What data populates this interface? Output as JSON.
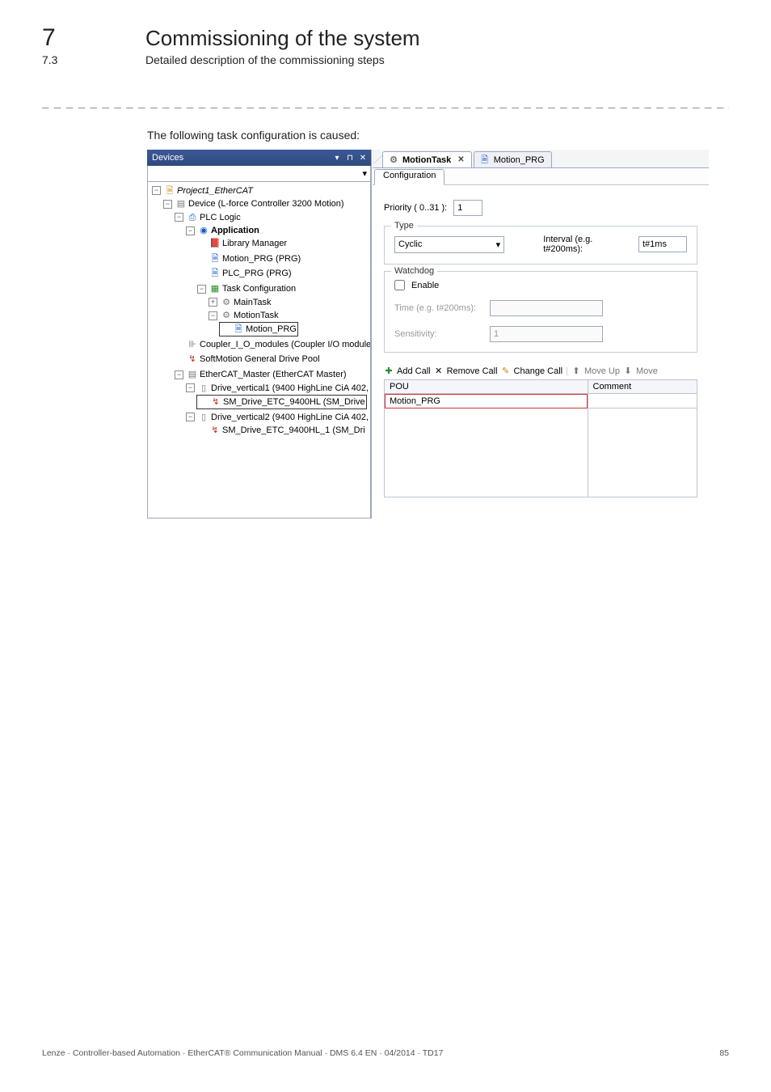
{
  "page": {
    "chapter_num": "7",
    "chapter_title": "Commissioning of the system",
    "section_num": "7.3",
    "section_title": "Detailed description of the commissioning steps",
    "intro": "The following task configuration is caused:",
    "footer_left": "Lenze · Controller-based Automation · EtherCAT® Communication Manual · DMS 6.4 EN · 04/2014 · TD17",
    "footer_right": "85"
  },
  "devices": {
    "title": "Devices",
    "combo_value": "Project1_EtherCAT",
    "tree": {
      "root_label": "Project1_EtherCAT",
      "device_label": "Device (L-force Controller 3200 Motion)",
      "plc_logic": "PLC Logic",
      "application": "Application",
      "library_manager": "Library Manager",
      "motion_prg": "Motion_PRG (PRG)",
      "plc_prg": "PLC_PRG (PRG)",
      "task_config": "Task Configuration",
      "main_task": "MainTask",
      "motion_task": "MotionTask",
      "motion_task_child": "Motion_PRG",
      "coupler": "Coupler_I_O_modules (Coupler I/O modules)",
      "softmotion": "SoftMotion General Drive Pool",
      "ecat_master": "EtherCAT_Master (EtherCAT Master)",
      "drive1": "Drive_vertical1 (9400 HighLine CiA 402,",
      "drive1_child": "SM_Drive_ETC_9400HL (SM_Drive",
      "drive2": "Drive_vertical2 (9400 HighLine CiA 402,",
      "drive2_child": "SM_Drive_ETC_9400HL_1 (SM_Dri"
    }
  },
  "editor": {
    "file_tabs": [
      {
        "label": "MotionTask",
        "active": true
      },
      {
        "label": "Motion_PRG",
        "active": false
      }
    ],
    "config_tab": "Configuration",
    "priority_label": "Priority ( 0..31 ):",
    "priority_value": "1",
    "type_group": "Type",
    "type_value": "Cyclic",
    "interval_label": "Interval (e.g. t#200ms):",
    "interval_value": "t#1ms",
    "watchdog_group": "Watchdog",
    "enable_label": "Enable",
    "time_label": "Time (e.g. t#200ms):",
    "sensitivity_label": "Sensitivity:",
    "sensitivity_value": "1",
    "toolbar": {
      "add": "Add Call",
      "remove": "Remove Call",
      "change": "Change Call",
      "up": "Move Up",
      "down": "Move"
    },
    "table": {
      "col_pou": "POU",
      "col_comment": "Comment",
      "row1_pou": "Motion_PRG",
      "row1_comment": ""
    }
  },
  "chart_data": null
}
